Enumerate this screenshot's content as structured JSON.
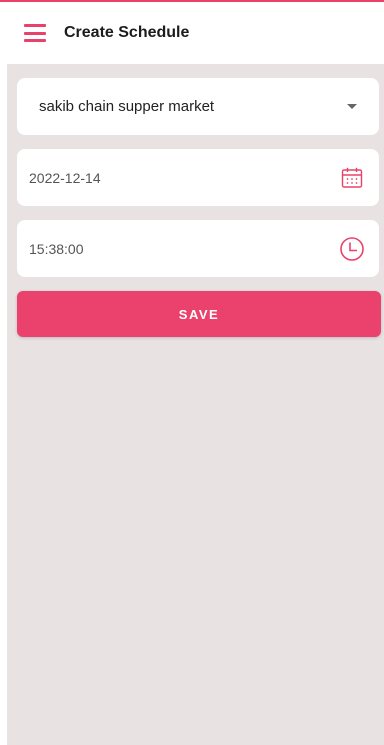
{
  "app_bar": {
    "title": "Create Schedule",
    "menu_icon": "hamburger-menu-icon"
  },
  "form": {
    "shop_select": {
      "value": "sakib chain supper market",
      "icon": "dropdown-caret-icon"
    },
    "date_field": {
      "value": "2022-12-14",
      "icon": "calendar-icon"
    },
    "time_field": {
      "value": "15:38:00",
      "icon": "clock-icon"
    },
    "save_label": "SAVE"
  },
  "colors": {
    "accent": "#e8426b",
    "background": "#e8e2e3",
    "card": "#ffffff"
  }
}
